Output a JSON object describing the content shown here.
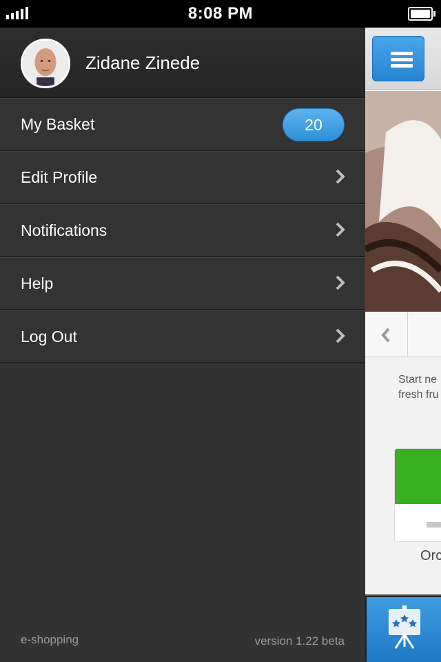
{
  "status_bar": {
    "time": "8:08 PM"
  },
  "profile": {
    "name": "Zidane Zinede"
  },
  "menu": {
    "items": [
      {
        "label": "My Basket",
        "badge": "20"
      },
      {
        "label": "Edit Profile"
      },
      {
        "label": "Notifications"
      },
      {
        "label": "Help"
      },
      {
        "label": "Log Out"
      }
    ]
  },
  "footer": {
    "app_name": "e-shopping",
    "version": "version 1.22 beta"
  },
  "main": {
    "description_line1": "Start ne",
    "description_line2": "fresh fru",
    "card_label": "Orc"
  },
  "icons": {
    "hamburger": "hamburger-menu-icon",
    "chevron": "chevron-right-icon",
    "prev": "chevron-left-icon",
    "tab": "presentation-stars-icon"
  },
  "colors": {
    "accent": "#2f8fd7",
    "menu_bg": "#323232",
    "green": "#38b020"
  }
}
